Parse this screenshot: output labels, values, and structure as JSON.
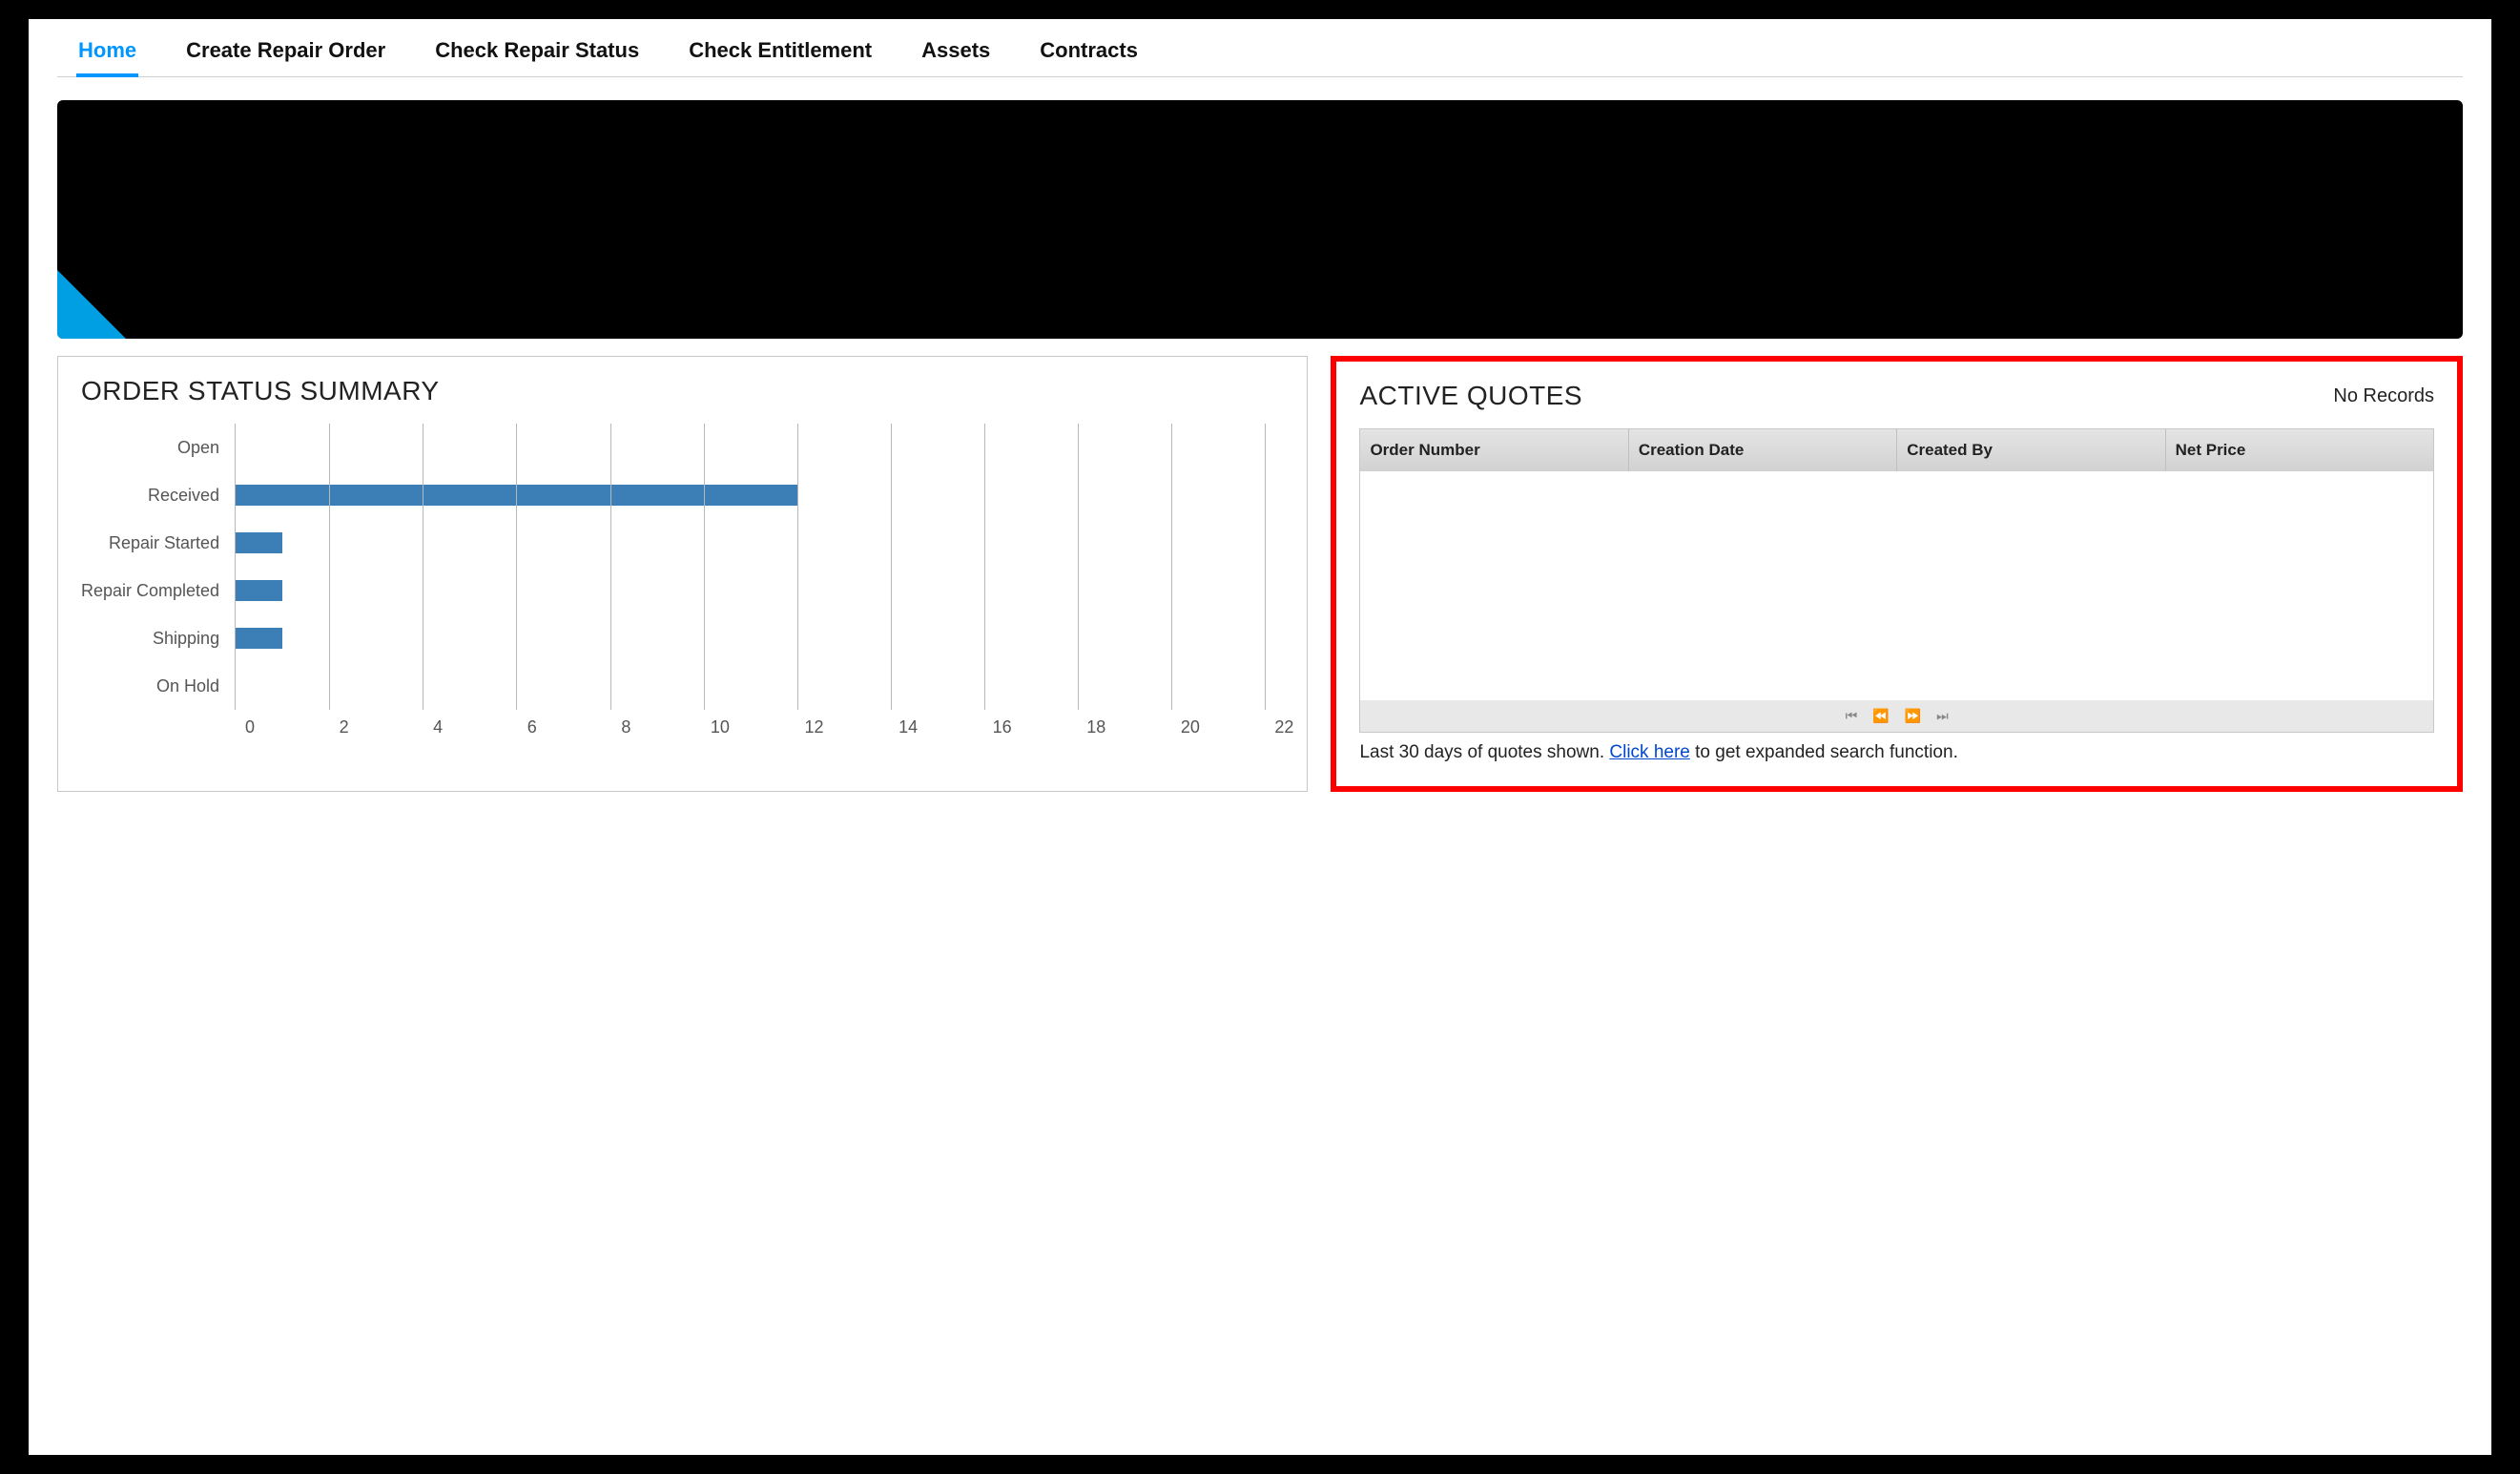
{
  "nav": {
    "items": [
      {
        "label": "Home",
        "active": true
      },
      {
        "label": "Create Repair Order",
        "active": false
      },
      {
        "label": "Check Repair Status",
        "active": false
      },
      {
        "label": "Check Entitlement",
        "active": false
      },
      {
        "label": "Assets",
        "active": false
      },
      {
        "label": "Contracts",
        "active": false
      }
    ]
  },
  "order_status": {
    "title": "ORDER STATUS SUMMARY"
  },
  "chart_data": {
    "type": "bar",
    "orientation": "horizontal",
    "categories": [
      "Open",
      "Received",
      "Repair Started",
      "Repair Completed",
      "Shipping",
      "On Hold"
    ],
    "values": [
      0,
      12,
      1,
      1,
      1,
      0
    ],
    "xlim": [
      0,
      22
    ],
    "xticks": [
      0,
      2,
      4,
      6,
      8,
      10,
      12,
      14,
      16,
      18,
      20,
      22
    ],
    "title": "ORDER STATUS SUMMARY",
    "xlabel": "",
    "ylabel": "",
    "color": "#3b7fb6"
  },
  "quotes": {
    "title": "ACTIVE QUOTES",
    "no_records": "No Records",
    "columns": [
      "Order Number",
      "Creation Date",
      "Created By",
      "Net Price"
    ],
    "rows": [],
    "footer_prefix": "Last 30 days of quotes shown. ",
    "footer_link": "Click here",
    "footer_suffix": " to get expanded search function."
  }
}
